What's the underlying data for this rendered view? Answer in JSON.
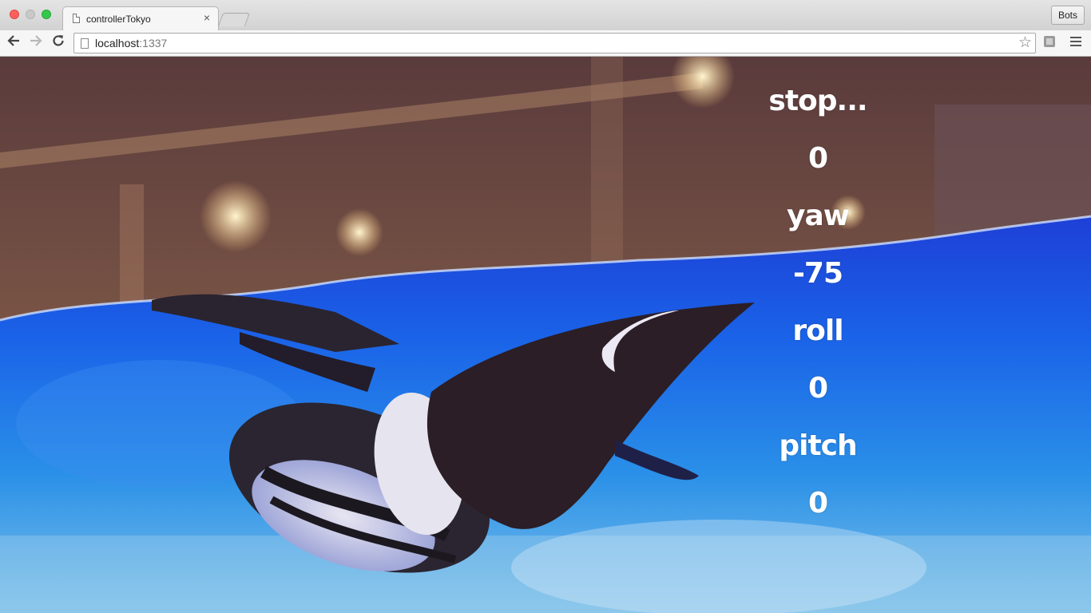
{
  "browser": {
    "tab_title": "controllerTokyo",
    "tab_close": "×",
    "url_host": "localhost",
    "url_port": ":1337",
    "profile_button": "Bots"
  },
  "background_image": {
    "description_icon": "penguin-swimming-photo"
  },
  "readout": {
    "status": "stop...",
    "status_value": "0",
    "yaw_label": "yaw",
    "yaw_value": "-75",
    "roll_label": "roll",
    "roll_value": "0",
    "pitch_label": "pitch",
    "pitch_value": "0"
  },
  "colors": {
    "water": "#1a4fe0",
    "readout_text": "#ffffff"
  }
}
